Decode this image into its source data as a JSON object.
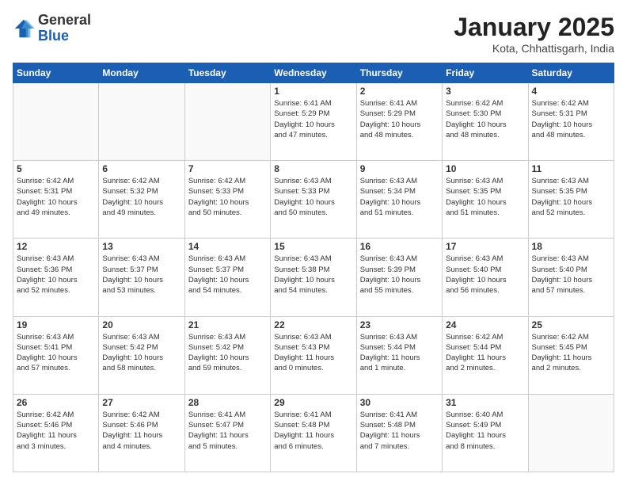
{
  "header": {
    "logo_general": "General",
    "logo_blue": "Blue",
    "month_title": "January 2025",
    "location": "Kota, Chhattisgarh, India"
  },
  "days_of_week": [
    "Sunday",
    "Monday",
    "Tuesday",
    "Wednesday",
    "Thursday",
    "Friday",
    "Saturday"
  ],
  "weeks": [
    [
      {
        "day": "",
        "info": ""
      },
      {
        "day": "",
        "info": ""
      },
      {
        "day": "",
        "info": ""
      },
      {
        "day": "1",
        "info": "Sunrise: 6:41 AM\nSunset: 5:29 PM\nDaylight: 10 hours\nand 47 minutes."
      },
      {
        "day": "2",
        "info": "Sunrise: 6:41 AM\nSunset: 5:29 PM\nDaylight: 10 hours\nand 48 minutes."
      },
      {
        "day": "3",
        "info": "Sunrise: 6:42 AM\nSunset: 5:30 PM\nDaylight: 10 hours\nand 48 minutes."
      },
      {
        "day": "4",
        "info": "Sunrise: 6:42 AM\nSunset: 5:31 PM\nDaylight: 10 hours\nand 48 minutes."
      }
    ],
    [
      {
        "day": "5",
        "info": "Sunrise: 6:42 AM\nSunset: 5:31 PM\nDaylight: 10 hours\nand 49 minutes."
      },
      {
        "day": "6",
        "info": "Sunrise: 6:42 AM\nSunset: 5:32 PM\nDaylight: 10 hours\nand 49 minutes."
      },
      {
        "day": "7",
        "info": "Sunrise: 6:42 AM\nSunset: 5:33 PM\nDaylight: 10 hours\nand 50 minutes."
      },
      {
        "day": "8",
        "info": "Sunrise: 6:43 AM\nSunset: 5:33 PM\nDaylight: 10 hours\nand 50 minutes."
      },
      {
        "day": "9",
        "info": "Sunrise: 6:43 AM\nSunset: 5:34 PM\nDaylight: 10 hours\nand 51 minutes."
      },
      {
        "day": "10",
        "info": "Sunrise: 6:43 AM\nSunset: 5:35 PM\nDaylight: 10 hours\nand 51 minutes."
      },
      {
        "day": "11",
        "info": "Sunrise: 6:43 AM\nSunset: 5:35 PM\nDaylight: 10 hours\nand 52 minutes."
      }
    ],
    [
      {
        "day": "12",
        "info": "Sunrise: 6:43 AM\nSunset: 5:36 PM\nDaylight: 10 hours\nand 52 minutes."
      },
      {
        "day": "13",
        "info": "Sunrise: 6:43 AM\nSunset: 5:37 PM\nDaylight: 10 hours\nand 53 minutes."
      },
      {
        "day": "14",
        "info": "Sunrise: 6:43 AM\nSunset: 5:37 PM\nDaylight: 10 hours\nand 54 minutes."
      },
      {
        "day": "15",
        "info": "Sunrise: 6:43 AM\nSunset: 5:38 PM\nDaylight: 10 hours\nand 54 minutes."
      },
      {
        "day": "16",
        "info": "Sunrise: 6:43 AM\nSunset: 5:39 PM\nDaylight: 10 hours\nand 55 minutes."
      },
      {
        "day": "17",
        "info": "Sunrise: 6:43 AM\nSunset: 5:40 PM\nDaylight: 10 hours\nand 56 minutes."
      },
      {
        "day": "18",
        "info": "Sunrise: 6:43 AM\nSunset: 5:40 PM\nDaylight: 10 hours\nand 57 minutes."
      }
    ],
    [
      {
        "day": "19",
        "info": "Sunrise: 6:43 AM\nSunset: 5:41 PM\nDaylight: 10 hours\nand 57 minutes."
      },
      {
        "day": "20",
        "info": "Sunrise: 6:43 AM\nSunset: 5:42 PM\nDaylight: 10 hours\nand 58 minutes."
      },
      {
        "day": "21",
        "info": "Sunrise: 6:43 AM\nSunset: 5:42 PM\nDaylight: 10 hours\nand 59 minutes."
      },
      {
        "day": "22",
        "info": "Sunrise: 6:43 AM\nSunset: 5:43 PM\nDaylight: 11 hours\nand 0 minutes."
      },
      {
        "day": "23",
        "info": "Sunrise: 6:43 AM\nSunset: 5:44 PM\nDaylight: 11 hours\nand 1 minute."
      },
      {
        "day": "24",
        "info": "Sunrise: 6:42 AM\nSunset: 5:44 PM\nDaylight: 11 hours\nand 2 minutes."
      },
      {
        "day": "25",
        "info": "Sunrise: 6:42 AM\nSunset: 5:45 PM\nDaylight: 11 hours\nand 2 minutes."
      }
    ],
    [
      {
        "day": "26",
        "info": "Sunrise: 6:42 AM\nSunset: 5:46 PM\nDaylight: 11 hours\nand 3 minutes."
      },
      {
        "day": "27",
        "info": "Sunrise: 6:42 AM\nSunset: 5:46 PM\nDaylight: 11 hours\nand 4 minutes."
      },
      {
        "day": "28",
        "info": "Sunrise: 6:41 AM\nSunset: 5:47 PM\nDaylight: 11 hours\nand 5 minutes."
      },
      {
        "day": "29",
        "info": "Sunrise: 6:41 AM\nSunset: 5:48 PM\nDaylight: 11 hours\nand 6 minutes."
      },
      {
        "day": "30",
        "info": "Sunrise: 6:41 AM\nSunset: 5:48 PM\nDaylight: 11 hours\nand 7 minutes."
      },
      {
        "day": "31",
        "info": "Sunrise: 6:40 AM\nSunset: 5:49 PM\nDaylight: 11 hours\nand 8 minutes."
      },
      {
        "day": "",
        "info": ""
      }
    ]
  ]
}
